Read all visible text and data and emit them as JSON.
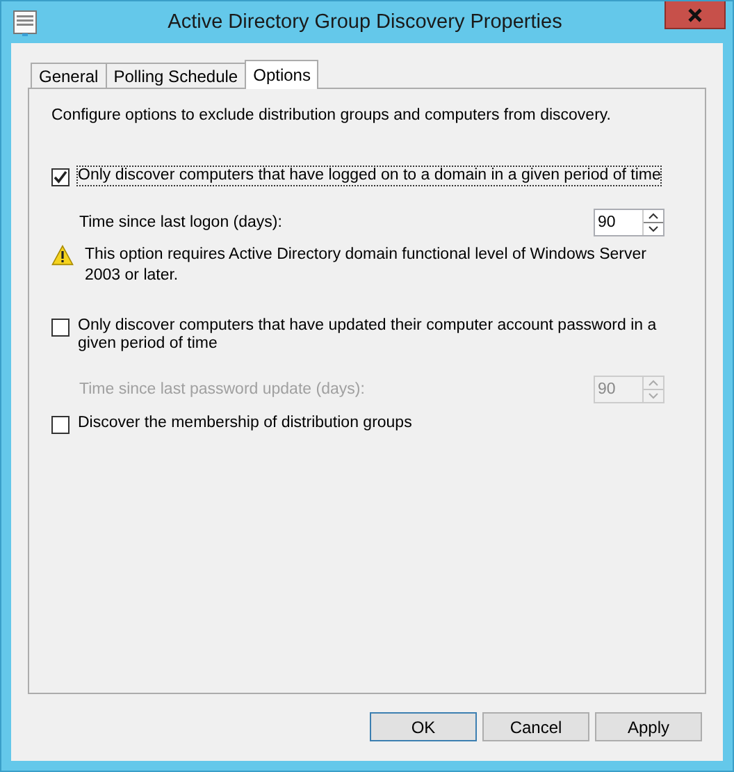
{
  "window": {
    "title": "Active Directory Group Discovery Properties"
  },
  "tabs": [
    {
      "label": "General",
      "selected": false
    },
    {
      "label": "Polling Schedule",
      "selected": false
    },
    {
      "label": "Options",
      "selected": true
    }
  ],
  "description": "Configure options to exclude distribution groups and computers from discovery.",
  "options": [
    {
      "kind": "checkbox",
      "label": "Only discover computers that have logged on to a domain in a given period of time",
      "checked": true,
      "focused": true
    },
    {
      "kind": "spinner",
      "label": "Time since last logon (days):",
      "value": "90",
      "disabled": false
    },
    {
      "kind": "warning",
      "text": "This option requires Active Directory domain functional level of Windows Server 2003 or later."
    },
    {
      "kind": "checkbox",
      "label": "Only discover computers that have updated their computer account password in a given period of time",
      "checked": false,
      "focused": false
    },
    {
      "kind": "spinner",
      "label": "Time since last password update (days):",
      "value": "90",
      "disabled": true
    },
    {
      "kind": "checkbox",
      "label": "Discover the membership of distribution groups",
      "checked": false,
      "focused": false
    }
  ],
  "buttons": [
    {
      "label": "OK",
      "default": true
    },
    {
      "label": "Cancel",
      "default": false
    },
    {
      "label": "Apply",
      "default": false
    }
  ]
}
